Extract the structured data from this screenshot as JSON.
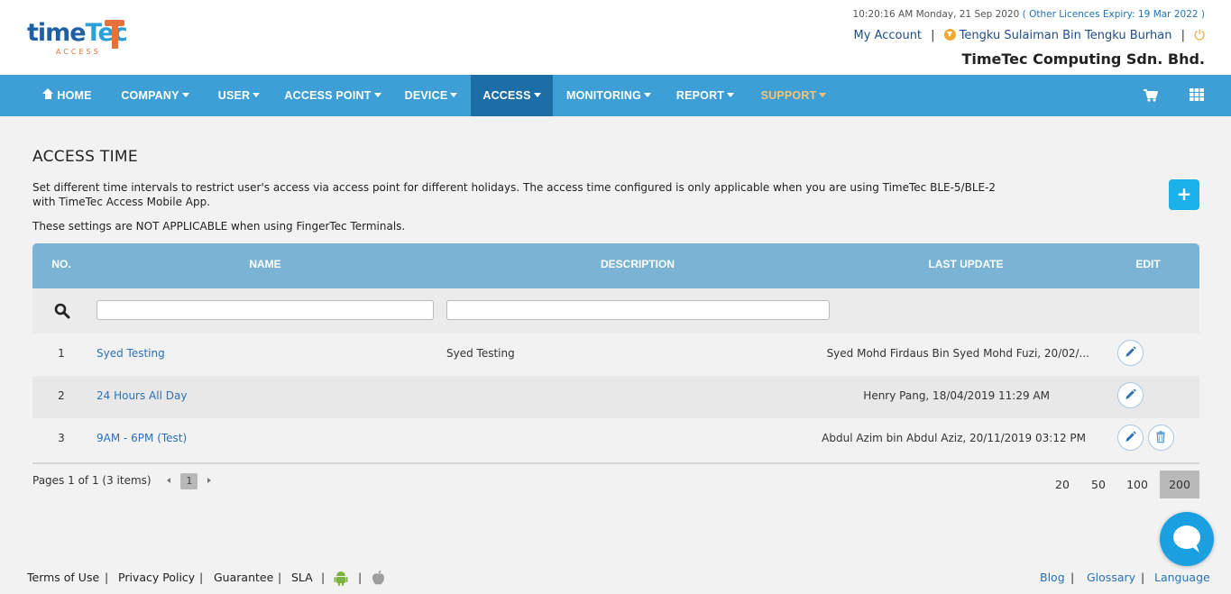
{
  "header": {
    "time": "10:20:16 AM Monday, 21 Sep 2020",
    "licence_text": "( Other Licences Expiry:  19 Mar 2022 )",
    "my_account": "My Account",
    "user_name": "Tengku Sulaiman Bin Tengku Burhan",
    "company": "TimeTec Computing Sdn. Bhd.",
    "logo_time": "time",
    "logo_tec": "Tec",
    "logo_sub": "ACCESS"
  },
  "nav": {
    "home": "HOME",
    "company": "COMPANY",
    "user": "USER",
    "access_point": "ACCESS POINT",
    "device": "DEVICE",
    "access": "ACCESS",
    "monitoring": "MONITORING",
    "report": "REPORT",
    "support": "SUPPORT"
  },
  "page": {
    "title": "ACCESS TIME",
    "description": "Set different time intervals to restrict user's access via access point for different holidays. The access time configured is only applicable when you are using TimeTec BLE-5/BLE-2 with TimeTec Access Mobile App.",
    "note": "These settings are NOT APPLICABLE when using FingerTec Terminals.",
    "add_label": "+"
  },
  "table": {
    "headers": {
      "no": "NO.",
      "name": "NAME",
      "description": "DESCRIPTION",
      "last_update": "LAST UPDATE",
      "edit": "EDIT"
    },
    "rows": [
      {
        "no": "1",
        "name": "Syed Testing",
        "description": "Syed Testing",
        "last_update": "Syed Mohd Firdaus Bin Syed Mohd Fuzi, 20/02/..."
      },
      {
        "no": "2",
        "name": "24 Hours All Day",
        "description": "",
        "last_update": "Henry Pang, 18/04/2019 11:29 AM"
      },
      {
        "no": "3",
        "name": "9AM - 6PM (Test)",
        "description": "",
        "last_update": "Abdul Azim bin Abdul Aziz, 20/11/2019 03:12 PM"
      }
    ]
  },
  "pager": {
    "summary": "Pages 1 of 1 (3 items)",
    "current": "1",
    "sizes": [
      "20",
      "50",
      "100",
      "200"
    ],
    "selected_size": "200"
  },
  "footer": {
    "terms": "Terms of Use",
    "privacy": "Privacy Policy",
    "guarantee": "Guarantee",
    "sla": "SLA",
    "blog": "Blog",
    "glossary": "Glossary",
    "language": "Language"
  },
  "colors": {
    "nav_bg": "#3e9fd6",
    "nav_active": "#1c6ea7",
    "table_header": "#7ab3d4",
    "link": "#2a72b5",
    "accent_orange": "#f0a830"
  }
}
